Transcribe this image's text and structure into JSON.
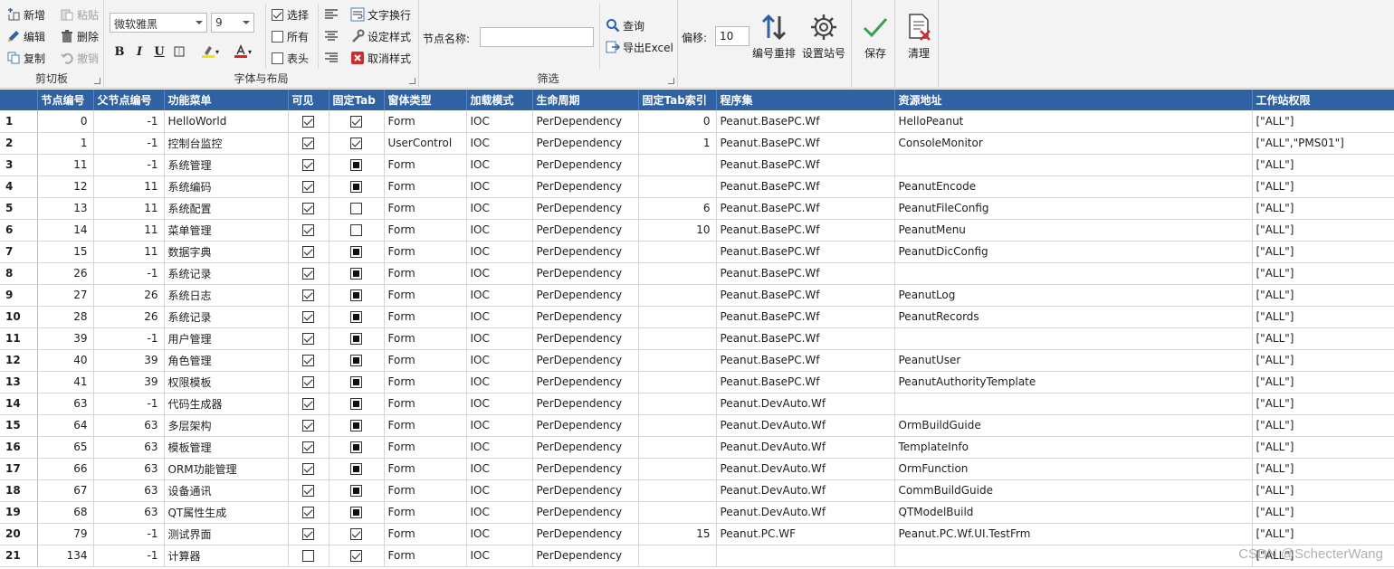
{
  "ribbon": {
    "clipboard": {
      "label": "剪切板",
      "add": "新增",
      "edit": "编辑",
      "copy": "复制",
      "paste": "粘贴",
      "delete": "删除",
      "undo": "撤销"
    },
    "font": {
      "label": "字体与布局",
      "font_name": "微软雅黑",
      "font_size": "9",
      "bold": "B",
      "italic": "I",
      "underline": "U",
      "select": "选择",
      "all": "所有",
      "header": "表头",
      "wrap": "文字换行",
      "set_style": "设定样式",
      "cancel_style": "取消样式"
    },
    "filter": {
      "label": "筛选",
      "node_name_label": "节点名称:",
      "node_name_value": "",
      "query": "查询",
      "export": "导出Excel"
    },
    "tools": {
      "offset_label": "偏移:",
      "offset_value": "10",
      "renumber": "编号重排",
      "set_station": "设置站号",
      "save": "保存",
      "clear": "清理"
    }
  },
  "grid": {
    "columns": [
      "节点编号",
      "父节点编号",
      "功能菜单",
      "可见",
      "固定Tab",
      "窗体类型",
      "加载模式",
      "生命周期",
      "固定Tab索引",
      "程序集",
      "资源地址",
      "工作站权限"
    ],
    "rows": [
      {
        "n": "1",
        "id": "0",
        "pid": "-1",
        "menu": "HelloWorld",
        "vis": "checked",
        "fix": "checked",
        "type": "Form",
        "mode": "IOC",
        "life": "PerDependency",
        "idx": "0",
        "asm": "Peanut.BasePC.Wf",
        "res": "HelloPeanut",
        "perm": "[\"ALL\"]"
      },
      {
        "n": "2",
        "id": "1",
        "pid": "-1",
        "menu": "控制台监控",
        "vis": "checked",
        "fix": "checked",
        "type": "UserControl",
        "mode": "IOC",
        "life": "PerDependency",
        "idx": "1",
        "asm": "Peanut.BasePC.Wf",
        "res": "ConsoleMonitor",
        "perm": "[\"ALL\",\"PMS01\"]"
      },
      {
        "n": "3",
        "id": "11",
        "pid": "-1",
        "menu": "系统管理",
        "vis": "checked",
        "fix": "indeterminate",
        "type": "Form",
        "mode": "IOC",
        "life": "PerDependency",
        "idx": "",
        "asm": "Peanut.BasePC.Wf",
        "res": "",
        "perm": "[\"ALL\"]"
      },
      {
        "n": "4",
        "id": "12",
        "pid": "11",
        "menu": "系统编码",
        "vis": "checked",
        "fix": "indeterminate",
        "type": "Form",
        "mode": "IOC",
        "life": "PerDependency",
        "idx": "",
        "asm": "Peanut.BasePC.Wf",
        "res": "PeanutEncode",
        "perm": "[\"ALL\"]"
      },
      {
        "n": "5",
        "id": "13",
        "pid": "11",
        "menu": "系统配置",
        "vis": "checked",
        "fix": "unchecked",
        "type": "Form",
        "mode": "IOC",
        "life": "PerDependency",
        "idx": "6",
        "asm": "Peanut.BasePC.Wf",
        "res": "PeanutFileConfig",
        "perm": "[\"ALL\"]"
      },
      {
        "n": "6",
        "id": "14",
        "pid": "11",
        "menu": "菜单管理",
        "vis": "checked",
        "fix": "unchecked",
        "type": "Form",
        "mode": "IOC",
        "life": "PerDependency",
        "idx": "10",
        "asm": "Peanut.BasePC.Wf",
        "res": "PeanutMenu",
        "perm": "[\"ALL\"]"
      },
      {
        "n": "7",
        "id": "15",
        "pid": "11",
        "menu": "数据字典",
        "vis": "checked",
        "fix": "indeterminate",
        "type": "Form",
        "mode": "IOC",
        "life": "PerDependency",
        "idx": "",
        "asm": "Peanut.BasePC.Wf",
        "res": "PeanutDicConfig",
        "perm": "[\"ALL\"]"
      },
      {
        "n": "8",
        "id": "26",
        "pid": "-1",
        "menu": "系统记录",
        "vis": "checked",
        "fix": "indeterminate",
        "type": "Form",
        "mode": "IOC",
        "life": "PerDependency",
        "idx": "",
        "asm": "Peanut.BasePC.Wf",
        "res": "",
        "perm": "[\"ALL\"]"
      },
      {
        "n": "9",
        "id": "27",
        "pid": "26",
        "menu": "系统日志",
        "vis": "checked",
        "fix": "indeterminate",
        "type": "Form",
        "mode": "IOC",
        "life": "PerDependency",
        "idx": "",
        "asm": "Peanut.BasePC.Wf",
        "res": "PeanutLog",
        "perm": "[\"ALL\"]"
      },
      {
        "n": "10",
        "id": "28",
        "pid": "26",
        "menu": "系统记录",
        "vis": "checked",
        "fix": "indeterminate",
        "type": "Form",
        "mode": "IOC",
        "life": "PerDependency",
        "idx": "",
        "asm": "Peanut.BasePC.Wf",
        "res": "PeanutRecords",
        "perm": "[\"ALL\"]"
      },
      {
        "n": "11",
        "id": "39",
        "pid": "-1",
        "menu": "用户管理",
        "vis": "checked",
        "fix": "indeterminate",
        "type": "Form",
        "mode": "IOC",
        "life": "PerDependency",
        "idx": "",
        "asm": "Peanut.BasePC.Wf",
        "res": "",
        "perm": "[\"ALL\"]"
      },
      {
        "n": "12",
        "id": "40",
        "pid": "39",
        "menu": "角色管理",
        "vis": "checked",
        "fix": "indeterminate",
        "type": "Form",
        "mode": "IOC",
        "life": "PerDependency",
        "idx": "",
        "asm": "Peanut.BasePC.Wf",
        "res": "PeanutUser",
        "perm": "[\"ALL\"]"
      },
      {
        "n": "13",
        "id": "41",
        "pid": "39",
        "menu": "权限模板",
        "vis": "checked",
        "fix": "indeterminate",
        "type": "Form",
        "mode": "IOC",
        "life": "PerDependency",
        "idx": "",
        "asm": "Peanut.BasePC.Wf",
        "res": "PeanutAuthorityTemplate",
        "perm": "[\"ALL\"]"
      },
      {
        "n": "14",
        "id": "63",
        "pid": "-1",
        "menu": "代码生成器",
        "vis": "checked",
        "fix": "indeterminate",
        "type": "Form",
        "mode": "IOC",
        "life": "PerDependency",
        "idx": "",
        "asm": "Peanut.DevAuto.Wf",
        "res": "",
        "perm": "[\"ALL\"]"
      },
      {
        "n": "15",
        "id": "64",
        "pid": "63",
        "menu": "多层架构",
        "vis": "checked",
        "fix": "indeterminate",
        "type": "Form",
        "mode": "IOC",
        "life": "PerDependency",
        "idx": "",
        "asm": "Peanut.DevAuto.Wf",
        "res": "OrmBuildGuide",
        "perm": "[\"ALL\"]"
      },
      {
        "n": "16",
        "id": "65",
        "pid": "63",
        "menu": "模板管理",
        "vis": "checked",
        "fix": "indeterminate",
        "type": "Form",
        "mode": "IOC",
        "life": "PerDependency",
        "idx": "",
        "asm": "Peanut.DevAuto.Wf",
        "res": "TemplateInfo",
        "perm": "[\"ALL\"]"
      },
      {
        "n": "17",
        "id": "66",
        "pid": "63",
        "menu": "ORM功能管理",
        "vis": "checked",
        "fix": "indeterminate",
        "type": "Form",
        "mode": "IOC",
        "life": "PerDependency",
        "idx": "",
        "asm": "Peanut.DevAuto.Wf",
        "res": "OrmFunction",
        "perm": "[\"ALL\"]"
      },
      {
        "n": "18",
        "id": "67",
        "pid": "63",
        "menu": "设备通讯",
        "vis": "checked",
        "fix": "indeterminate",
        "type": "Form",
        "mode": "IOC",
        "life": "PerDependency",
        "idx": "",
        "asm": "Peanut.DevAuto.Wf",
        "res": "CommBuildGuide",
        "perm": "[\"ALL\"]"
      },
      {
        "n": "19",
        "id": "68",
        "pid": "63",
        "menu": "QT属性生成",
        "vis": "checked",
        "fix": "indeterminate",
        "type": "Form",
        "mode": "IOC",
        "life": "PerDependency",
        "idx": "",
        "asm": "Peanut.DevAuto.Wf",
        "res": "QTModelBuild",
        "perm": "[\"ALL\"]"
      },
      {
        "n": "20",
        "id": "79",
        "pid": "-1",
        "menu": "测试界面",
        "vis": "checked",
        "fix": "checked",
        "type": "Form",
        "mode": "IOC",
        "life": "PerDependency",
        "idx": "15",
        "asm": "Peanut.PC.WF",
        "res": "Peanut.PC.Wf.UI.TestFrm",
        "perm": "[\"ALL\"]"
      },
      {
        "n": "21",
        "id": "134",
        "pid": "-1",
        "menu": "计算器",
        "vis": "unchecked",
        "fix": "checked",
        "type": "Form",
        "mode": "IOC",
        "life": "PerDependency",
        "idx": "",
        "asm": "",
        "res": "",
        "perm": "[\"ALL\"]"
      }
    ]
  },
  "watermark": "CSDN @SchecterWang",
  "colors": {
    "header_bg": "#2f62a3",
    "ribbon_bg": "#f3f3f3"
  }
}
